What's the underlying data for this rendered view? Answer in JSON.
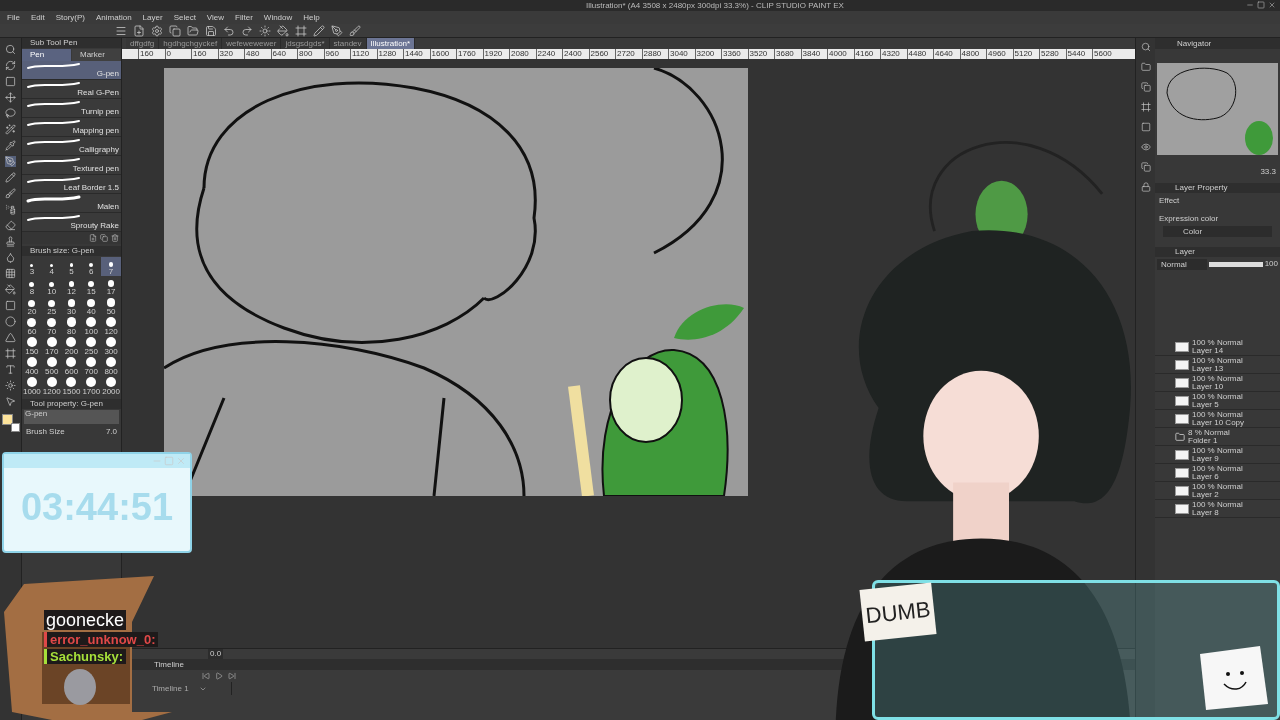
{
  "window": {
    "title": "Illustration* (A4 3508 x 2480px 300dpi 33.3%) - CLIP STUDIO PAINT EX",
    "menu": [
      "File",
      "Edit",
      "Story(P)",
      "Animation",
      "Layer",
      "Select",
      "View",
      "Filter",
      "Window",
      "Help"
    ]
  },
  "document_tabs": [
    {
      "label": "dffgdfg",
      "selected": false
    },
    {
      "label": "hgdhgchgyckef",
      "selected": false
    },
    {
      "label": "wefewewewer",
      "selected": false
    },
    {
      "label": "jdsgsdgds*",
      "selected": false
    },
    {
      "label": "standev",
      "selected": false
    },
    {
      "label": "Illustration*",
      "selected": true
    }
  ],
  "ruler": [
    "160",
    "0",
    "160",
    "320",
    "480",
    "640",
    "800",
    "960",
    "1120",
    "1280",
    "1440",
    "1600",
    "1760",
    "1920",
    "2080",
    "2240",
    "2400",
    "2560",
    "2720",
    "2880",
    "3040",
    "3200",
    "3360",
    "3520",
    "3680",
    "3840",
    "4000",
    "4160",
    "4320",
    "4480",
    "4640",
    "4800",
    "4960",
    "5120",
    "5280",
    "5440",
    "5600"
  ],
  "sub_tool": {
    "title": "Sub Tool Pen",
    "tabs": [
      {
        "label": "Pen",
        "selected": true
      },
      {
        "label": "Marker",
        "selected": false
      }
    ],
    "brushes": [
      {
        "name": "G-pen",
        "selected": true
      },
      {
        "name": "Real G-Pen",
        "selected": false
      },
      {
        "name": "Turnip pen",
        "selected": false
      },
      {
        "name": "Mapping pen",
        "selected": false
      },
      {
        "name": "Calligraphy",
        "selected": false
      },
      {
        "name": "Textured pen",
        "selected": false
      },
      {
        "name": "Leaf Border 1.5",
        "selected": false
      },
      {
        "name": "Malen",
        "selected": false
      },
      {
        "name": "Sprouty Rake",
        "selected": false
      }
    ]
  },
  "brush_size": {
    "title": "Brush size: G-pen",
    "sizes": [
      {
        "label": "3",
        "selected": false
      },
      {
        "label": "4",
        "selected": false
      },
      {
        "label": "5",
        "selected": false
      },
      {
        "label": "6",
        "selected": false
      },
      {
        "label": "7",
        "selected": true
      },
      {
        "label": "8",
        "selected": false
      },
      {
        "label": "10",
        "selected": false
      },
      {
        "label": "12",
        "selected": false
      },
      {
        "label": "15",
        "selected": false
      },
      {
        "label": "17",
        "selected": false
      },
      {
        "label": "20",
        "selected": false
      },
      {
        "label": "25",
        "selected": false
      },
      {
        "label": "30",
        "selected": false
      },
      {
        "label": "40",
        "selected": false
      },
      {
        "label": "50",
        "selected": false
      },
      {
        "label": "60",
        "selected": false
      },
      {
        "label": "70",
        "selected": false
      },
      {
        "label": "80",
        "selected": false
      },
      {
        "label": "100",
        "selected": false
      },
      {
        "label": "120",
        "selected": false
      },
      {
        "label": "150",
        "selected": false
      },
      {
        "label": "170",
        "selected": false
      },
      {
        "label": "200",
        "selected": false
      },
      {
        "label": "250",
        "selected": false
      },
      {
        "label": "300",
        "selected": false
      },
      {
        "label": "400",
        "selected": false
      },
      {
        "label": "500",
        "selected": false
      },
      {
        "label": "600",
        "selected": false
      },
      {
        "label": "700",
        "selected": false
      },
      {
        "label": "800",
        "selected": false
      },
      {
        "label": "1000",
        "selected": false
      },
      {
        "label": "1200",
        "selected": false
      },
      {
        "label": "1500",
        "selected": false
      },
      {
        "label": "1700",
        "selected": false
      },
      {
        "label": "2000",
        "selected": false
      }
    ]
  },
  "tool_property": {
    "title": "Tool property: G-pen",
    "preview_label": "G-pen",
    "brush_size_label": "Brush Size",
    "brush_size_value": "7.0"
  },
  "navigator": {
    "title": "Navigator",
    "zoom": "33.3"
  },
  "layer_property": {
    "title": "Layer Property",
    "effect_label": "Effect",
    "expression_color_label": "Expression color",
    "expression_color": "Color"
  },
  "layers": {
    "title": "Layer",
    "blend_mode": "Normal",
    "opacity": "100",
    "items": [
      {
        "kind": "layer",
        "info": "100 % Normal",
        "name": "Layer 14"
      },
      {
        "kind": "layer",
        "info": "100 % Normal",
        "name": "Layer 13"
      },
      {
        "kind": "layer",
        "info": "100 % Normal",
        "name": "Layer 10"
      },
      {
        "kind": "layer",
        "info": "100 % Normal",
        "name": "Layer 5"
      },
      {
        "kind": "layer",
        "info": "100 % Normal",
        "name": "Layer 10 Copy"
      },
      {
        "kind": "folder",
        "info": "8 % Normal",
        "name": "Folder 1"
      },
      {
        "kind": "layer",
        "info": "100 % Normal",
        "name": "Layer 9"
      },
      {
        "kind": "layer",
        "info": "100 % Normal",
        "name": "Layer 6"
      },
      {
        "kind": "layer",
        "info": "100 % Normal",
        "name": "Layer 2"
      },
      {
        "kind": "layer",
        "info": "100 % Normal",
        "name": "Layer 8"
      }
    ]
  },
  "timeline": {
    "title": "Timeline",
    "track": "Timeline 1",
    "frame": "0.0"
  },
  "overlay": {
    "timer": "03:44:51",
    "chat": {
      "title": "goonecke",
      "messages": [
        {
          "user": "error_unknow_0:",
          "color": "#e04848"
        },
        {
          "user": "Sachunsky:",
          "color": "#a6e03a"
        }
      ]
    },
    "sticky_note": "DUMB"
  }
}
